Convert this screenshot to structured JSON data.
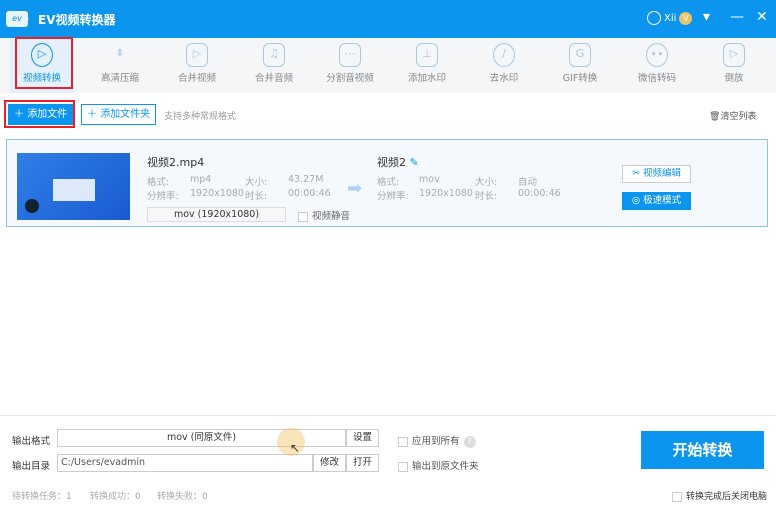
{
  "app": {
    "title": "EV视频转换器",
    "user": "Xii",
    "vip": "V"
  },
  "tools": [
    "视频转换",
    "高清压缩",
    "合并视频",
    "合并音频",
    "分割音视频",
    "添加水印",
    "去水印",
    "GIF转换",
    "微信转码",
    "倒放"
  ],
  "actions": {
    "add_file": "添加文件",
    "add_folder": "添加文件夹",
    "hint": "支持多种常规格式",
    "clear": "清空列表"
  },
  "file": {
    "name": "视频2.mp4",
    "format_label": "格式:",
    "format": "mp4",
    "size_label": "大小:",
    "size": "43.27M",
    "res_label": "分辨率:",
    "res": "1920x1080",
    "dur_label": "时长:",
    "duration": "00:00:46",
    "output_format": "mov (1920x1080)",
    "mute": "视频静音",
    "out_name": "视频2",
    "out_format": "mov",
    "out_size": "自动",
    "out_res": "1920x1080",
    "out_duration": "00:00:46",
    "edit": "视频编辑",
    "fast": "极速模式"
  },
  "bottom": {
    "format_label": "输出格式",
    "format_value": "mov (同原文件)",
    "settings": "设置",
    "apply_all": "应用到所有",
    "help": "?",
    "dir_label": "输出目录",
    "dir_value": "C:/Users/evadmin",
    "modify": "修改",
    "open": "打开",
    "to_source": "输出到原文件夹",
    "start": "开始转换",
    "shutdown": "转换完成后关闭电脑",
    "pending": "待转换任务：1",
    "success": "转换成功：0",
    "failed": "转换失败：0"
  },
  "colors": {
    "accent": "#0b95ee",
    "highlight": "#e8202a"
  }
}
